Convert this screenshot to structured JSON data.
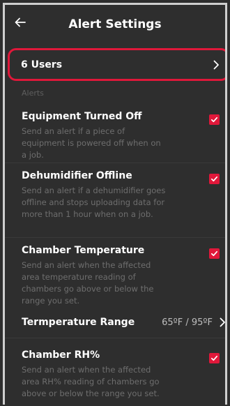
{
  "header": {
    "title": "Alert Settings",
    "back_icon": "arrow-left-icon"
  },
  "users": {
    "label": "6 Users",
    "icon": "chevron-right-icon"
  },
  "alerts_section": {
    "label": "Alerts"
  },
  "alerts": [
    {
      "title": "Equipment Turned Off",
      "description": "Send an alert if a piece of equipment is powered off when on a job.",
      "checked": true
    },
    {
      "title": "Dehumidifier Offline",
      "description": "Send an alert if a dehumidifier goes offline and stops uploading data for more than 1 hour when on a job.",
      "checked": true
    },
    {
      "title": "Chamber Temperature",
      "description": "Send an alert when the affected area temperature reading of chambers go above or below the range you set.",
      "checked": true
    },
    {
      "title": "Chamber RH%",
      "description": "Send an alert when the affected area RH% reading of chambers go above or below the range you set.",
      "checked": true
    }
  ],
  "temperature_range": {
    "label": "Termperature Range",
    "value": "65ºF / 95ºF",
    "icon": "chevron-right-icon"
  },
  "colors": {
    "background": "#2e2e2e",
    "accent": "#e0183a",
    "text_primary": "#ffffff",
    "text_secondary": "#6e6e6e"
  }
}
